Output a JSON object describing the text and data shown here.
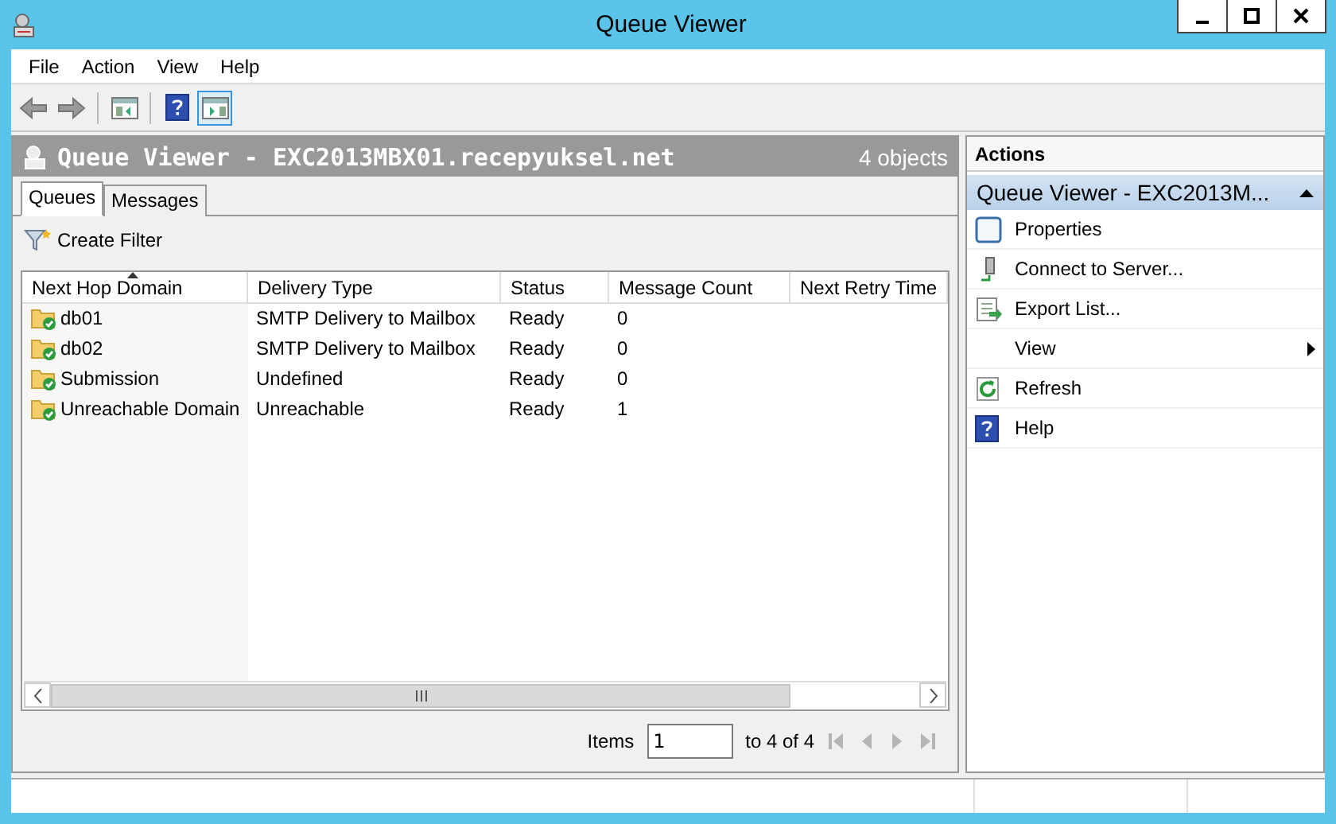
{
  "window": {
    "title": "Queue Viewer"
  },
  "menu": [
    "File",
    "Action",
    "View",
    "Help"
  ],
  "toolbar": [
    {
      "kind": "back",
      "selected": false
    },
    {
      "kind": "forward",
      "selected": false
    },
    {
      "kind": "console-tree",
      "selected": false
    },
    {
      "kind": "help",
      "selected": false
    },
    {
      "kind": "action-pane",
      "selected": true
    }
  ],
  "pane": {
    "title": "Queue Viewer - EXC2013MBX01.recepyuksel.net",
    "count": "4 objects",
    "tabs": [
      {
        "label": "Queues",
        "selected": true
      },
      {
        "label": "Messages",
        "selected": false
      }
    ],
    "filter": "Create Filter",
    "columns": [
      {
        "label": "Next Hop Domain",
        "sorted": true
      },
      {
        "label": "Delivery Type",
        "sorted": false
      },
      {
        "label": "Status",
        "sorted": false
      },
      {
        "label": "Message Count",
        "sorted": false
      },
      {
        "label": "Next Retry Time",
        "sorted": false
      }
    ],
    "rows": [
      {
        "cells": [
          "db01",
          "SMTP Delivery to Mailbox",
          "Ready",
          "0"
        ]
      },
      {
        "cells": [
          "db02",
          "SMTP Delivery to Mailbox",
          "Ready",
          "0"
        ]
      },
      {
        "cells": [
          "Submission",
          "Undefined",
          "Ready",
          "0"
        ]
      },
      {
        "cells": [
          "Unreachable Domain",
          "Unreachable",
          "Ready",
          "1"
        ]
      }
    ],
    "pager": {
      "label": "Items",
      "value": "1",
      "range": "to 4 of 4",
      "nav": [
        {
          "kind": "first",
          "disabled": true
        },
        {
          "kind": "prev",
          "disabled": true
        },
        {
          "kind": "next",
          "disabled": true
        },
        {
          "kind": "last",
          "disabled": true
        }
      ]
    }
  },
  "actions": {
    "header": "Actions",
    "section": "Queue Viewer - EXC2013M...",
    "expanded": true,
    "items": [
      {
        "kind": "properties",
        "label": "Properties",
        "submenu": false
      },
      {
        "kind": "server",
        "label": "Connect to Server...",
        "submenu": false
      },
      {
        "kind": "export",
        "label": "Export List...",
        "submenu": false
      },
      {
        "kind": "none",
        "label": "View",
        "submenu": true
      },
      {
        "kind": "refresh",
        "label": "Refresh",
        "submenu": false
      },
      {
        "kind": "help",
        "label": "Help",
        "submenu": false
      }
    ]
  }
}
